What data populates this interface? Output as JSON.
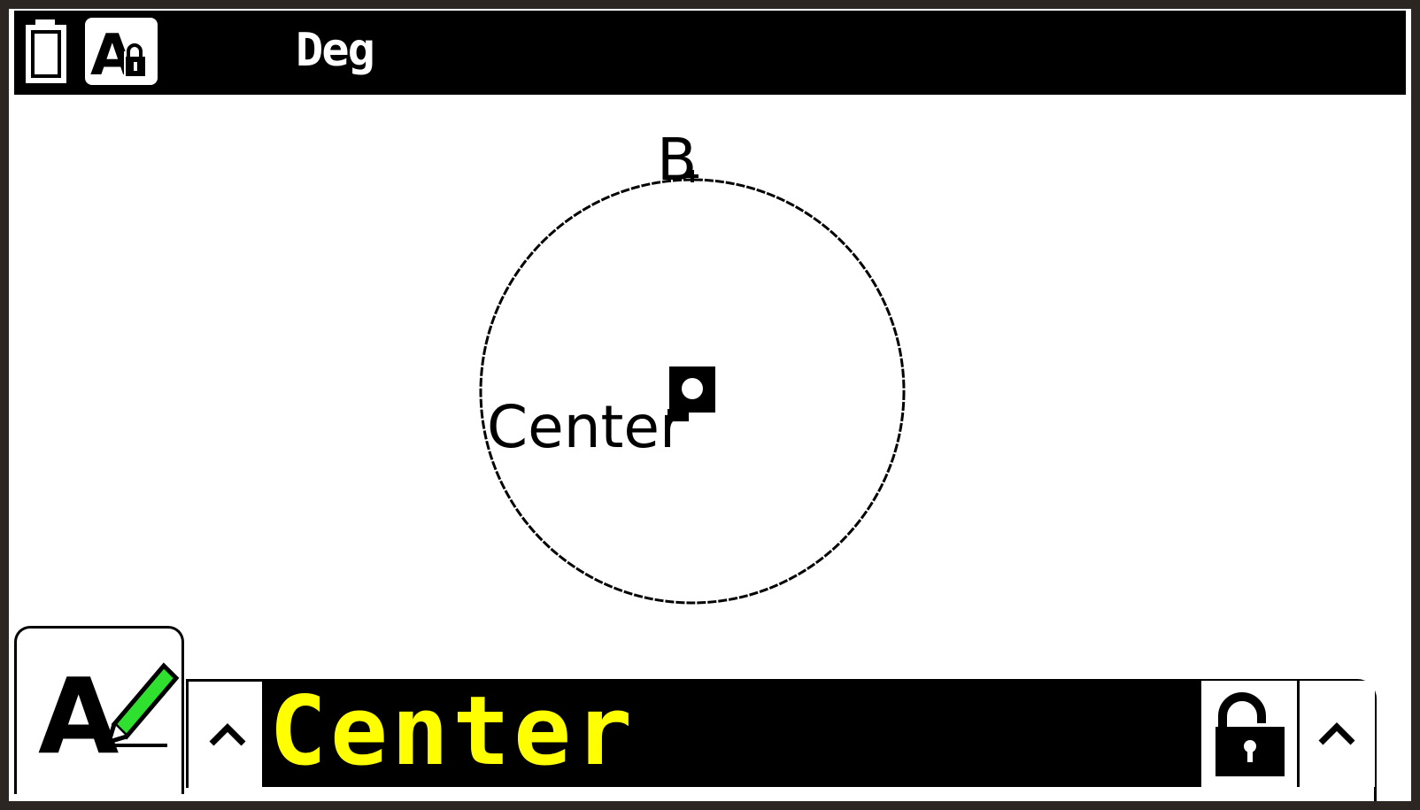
{
  "status_bar": {
    "battery_icon": "battery-icon",
    "font_lock_icon": "alpha-lock-icon",
    "angle_mode": "Deg"
  },
  "canvas": {
    "point_labels": {
      "center": "Center",
      "b": "B"
    }
  },
  "input_bar": {
    "mode_icon": "text-edit-pencil-icon",
    "left_caret": "^",
    "value": "Center",
    "lock_icon": "unlock-icon",
    "right_caret": "^"
  },
  "colors": {
    "frame": "#2b2622",
    "status_bg": "#000000",
    "input_bg": "#000000",
    "input_text": "#ffff00",
    "pencil_green": "#2fe02f"
  }
}
